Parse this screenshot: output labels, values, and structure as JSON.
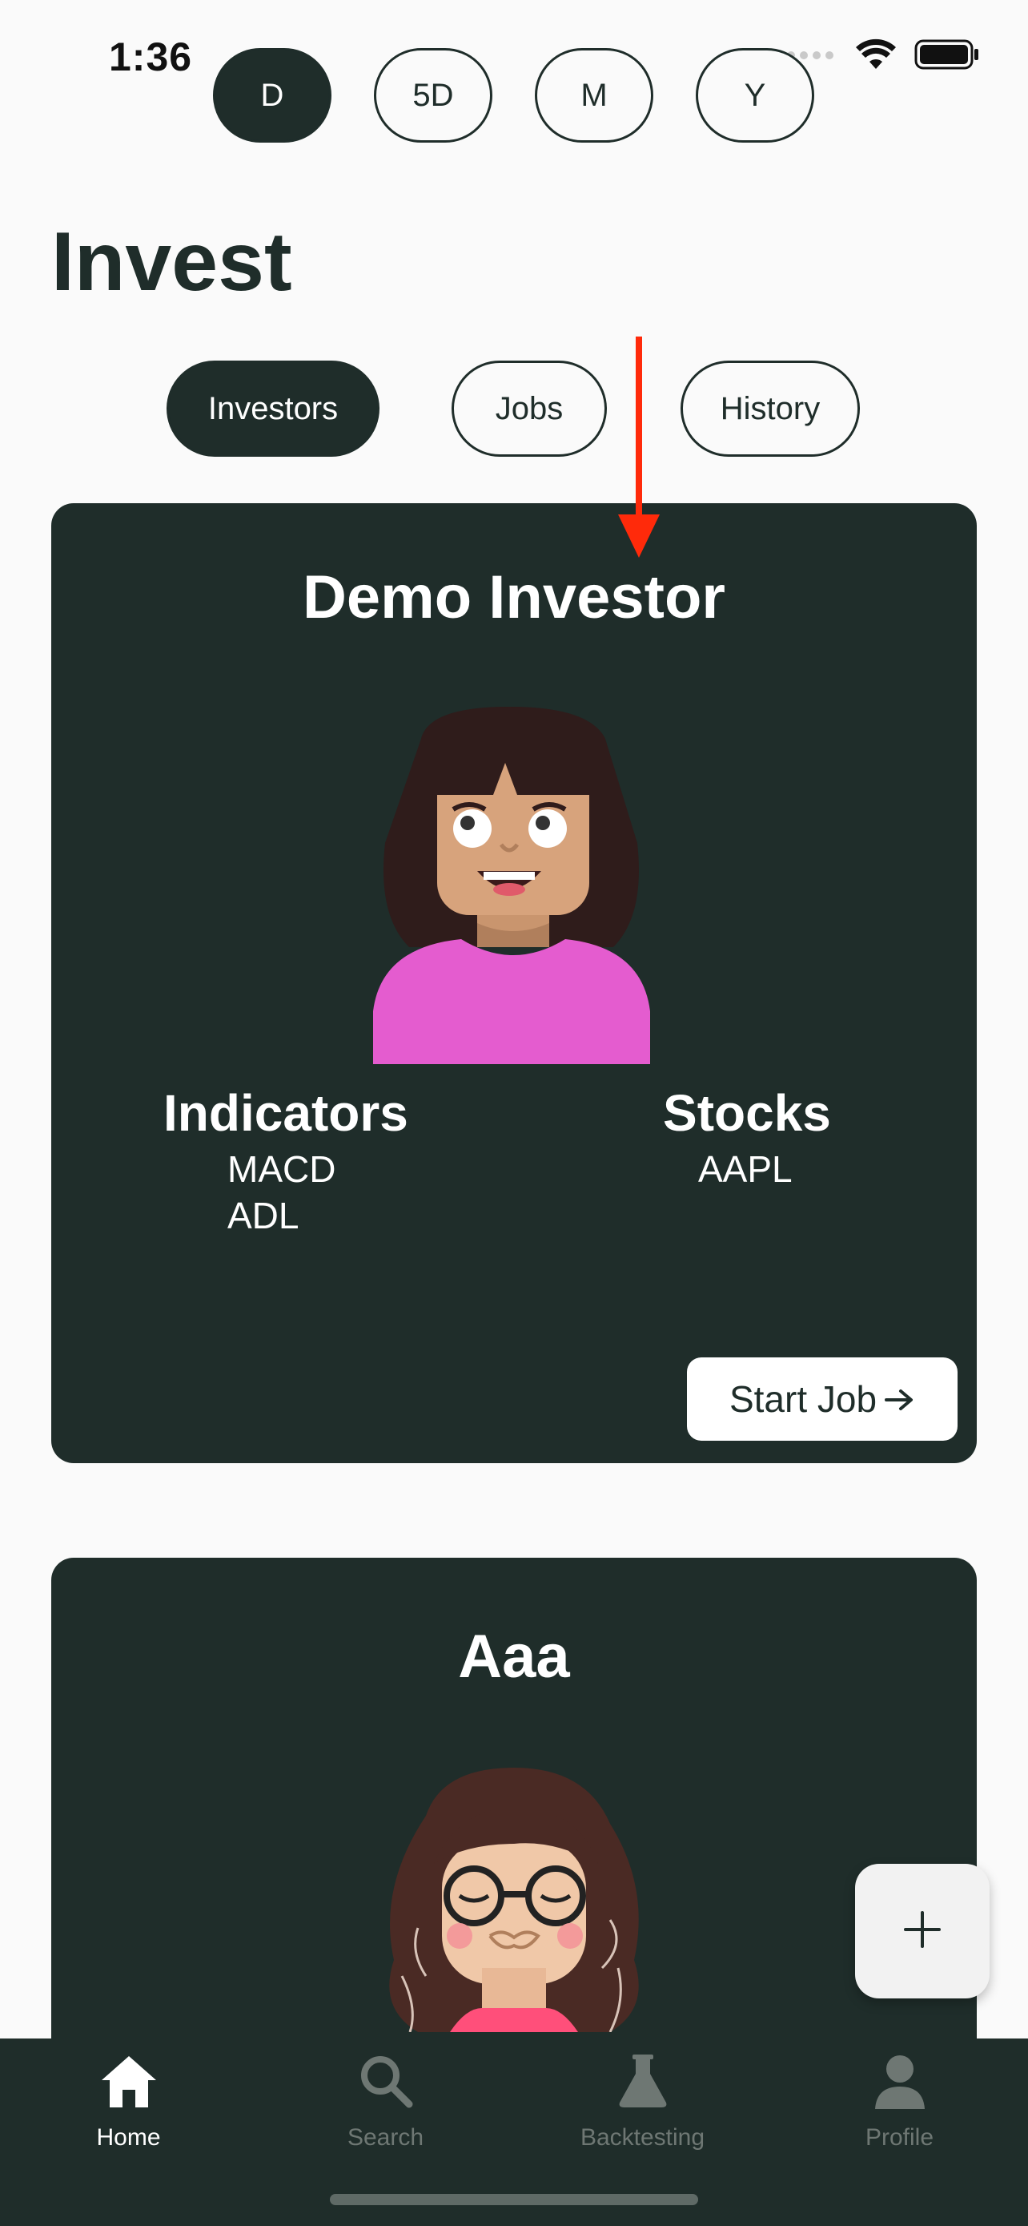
{
  "status_bar": {
    "time": "1:36"
  },
  "timeframes": [
    {
      "label": "D",
      "active": true
    },
    {
      "label": "5D",
      "active": false
    },
    {
      "label": "M",
      "active": false
    },
    {
      "label": "Y",
      "active": false
    }
  ],
  "page": {
    "title": "Invest"
  },
  "tabs": [
    {
      "label": "Investors",
      "active": true
    },
    {
      "label": "Jobs",
      "active": false
    },
    {
      "label": "History",
      "active": false
    }
  ],
  "investors": [
    {
      "name": "Demo Investor",
      "indicators_heading": "Indicators",
      "indicators": [
        "MACD",
        "ADL"
      ],
      "stocks_heading": "Stocks",
      "stocks": [
        "AAPL"
      ],
      "start_job_label": "Start Job"
    },
    {
      "name": "Aaa"
    }
  ],
  "fab": {
    "icon": "plus-icon"
  },
  "bottom_nav": [
    {
      "label": "Home",
      "icon": "home-icon",
      "active": true
    },
    {
      "label": "Search",
      "icon": "search-icon",
      "active": false
    },
    {
      "label": "Backtesting",
      "icon": "flask-icon",
      "active": false
    },
    {
      "label": "Profile",
      "icon": "person-icon",
      "active": false
    }
  ],
  "colors": {
    "primary": "#1f2d2a",
    "background": "#fafafa",
    "annotation_arrow": "#ff2a0a"
  }
}
